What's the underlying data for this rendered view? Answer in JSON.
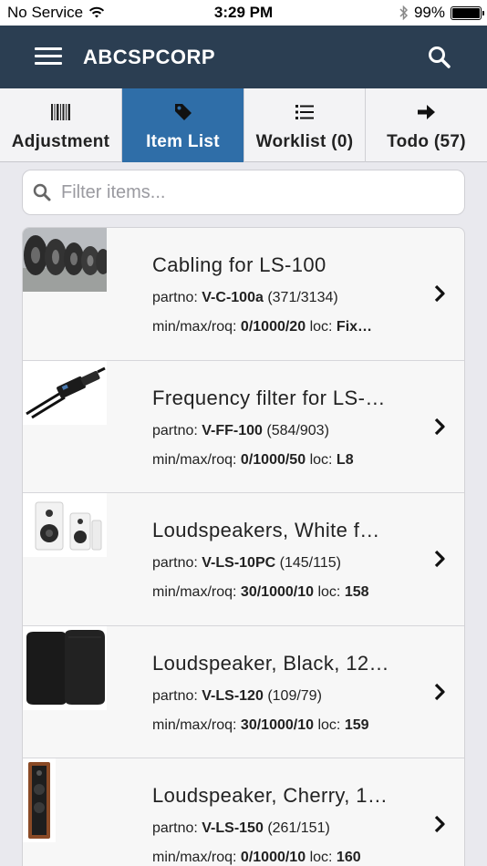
{
  "status": {
    "carrier": "No Service",
    "time": "3:29 PM",
    "battery": "99%",
    "battery_level": 0.99
  },
  "header": {
    "title": "ABCSPCORP"
  },
  "tabs": [
    {
      "label": "Adjustment",
      "icon": "barcode-icon"
    },
    {
      "label": "Item List",
      "icon": "tag-icon",
      "active": true
    },
    {
      "label": "Worklist (0)",
      "icon": "list-icon"
    },
    {
      "label": "Todo (57)",
      "icon": "arrow-right-icon"
    }
  ],
  "filter": {
    "placeholder": "Filter items..."
  },
  "items": [
    {
      "title": "Cabling for LS-100",
      "partno_label": "partno:",
      "partno": "V-C-100a",
      "qty": "(371/3134)",
      "mmr_label": "min/max/roq:",
      "mmr": "0/1000/20",
      "loc_label": "loc:",
      "loc": "Fix…",
      "image": "cable-reels"
    },
    {
      "title": "Frequency filter for LS-…",
      "partno_label": "partno:",
      "partno": "V-FF-100",
      "qty": "(584/903)",
      "mmr_label": "min/max/roq:",
      "mmr": "0/1000/50",
      "loc_label": "loc:",
      "loc": "L8",
      "image": "filter-device"
    },
    {
      "title": "Loudspeakers, White f…",
      "partno_label": "partno:",
      "partno": "V-LS-10PC",
      "qty": "(145/115)",
      "mmr_label": "min/max/roq:",
      "mmr": "30/1000/10",
      "loc_label": "loc:",
      "loc": "158",
      "image": "white-speakers"
    },
    {
      "title": "Loudspeaker, Black, 12…",
      "partno_label": "partno:",
      "partno": "V-LS-120",
      "qty": "(109/79)",
      "mmr_label": "min/max/roq:",
      "mmr": "30/1000/10",
      "loc_label": "loc:",
      "loc": "159",
      "image": "black-speakers"
    },
    {
      "title": "Loudspeaker, Cherry, 1…",
      "partno_label": "partno:",
      "partno": "V-LS-150",
      "qty": "(261/151)",
      "mmr_label": "min/max/roq:",
      "mmr": "0/1000/10",
      "loc_label": "loc:",
      "loc": "160",
      "image": "cherry-speaker"
    }
  ],
  "colors": {
    "navbar": "#2b3e52",
    "active_tab": "#2f6ea8"
  }
}
